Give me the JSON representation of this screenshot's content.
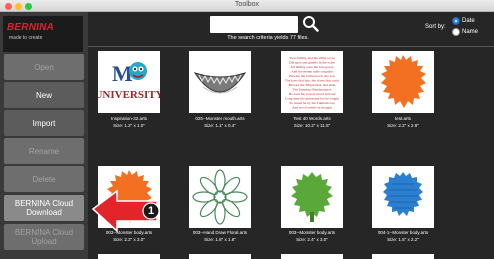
{
  "window": {
    "title": "Toolbox"
  },
  "logo": {
    "brand": "BERNINA",
    "tagline": "made to create"
  },
  "sidebar": {
    "buttons": [
      {
        "label": "Open",
        "state": "disabled"
      },
      {
        "label": "New",
        "state": "enabled"
      },
      {
        "label": "Import",
        "state": "enabled"
      },
      {
        "label": "Rename",
        "state": "disabled"
      },
      {
        "label": "Delete",
        "state": "disabled"
      },
      {
        "label": "BERNINA Cloud Download",
        "state": "active"
      },
      {
        "label": "BERNINA Cloud Upload",
        "state": "disabled"
      }
    ]
  },
  "search": {
    "value": "",
    "criteria_text": "The search criteria yields 77 files."
  },
  "sort": {
    "label": "Sort by:",
    "options": [
      {
        "label": "Date",
        "checked": true
      },
      {
        "label": "Name",
        "checked": false
      }
    ]
  },
  "files": [
    {
      "name": "Inspiration-32.arts",
      "size": "Size: 1.2\" x 1.0\"",
      "thumb": "university-monster-icon"
    },
    {
      "name": "025--Monster mouth.arts",
      "size": "Size: 1.1\" x 0.4\"",
      "thumb": "monster-mouth-icon"
    },
    {
      "name": "Test 40 Words.arts",
      "size": "Size: 10.2\" x 11.5\"",
      "thumb": "text-page-icon"
    },
    {
      "name": "test.arts",
      "size": "Size: 2.2\" x 2.9\"",
      "thumb": "orange-fur-icon"
    },
    {
      "name": "003--Monster body.arts",
      "size": "Size: 2.2\" x 2.0\"",
      "thumb": "orange-fur-icon"
    },
    {
      "name": "003--Hand Draw Floral.arts",
      "size": "Size: 1.8\" x 1.8\"",
      "thumb": "flower-outline-icon"
    },
    {
      "name": "003--Monster body.arts",
      "size": "Size: 2.4\" x 3.0\"",
      "thumb": "green-fur-icon"
    },
    {
      "name": "004-1--Monster body.arts",
      "size": "Size: 1.5\" x 2.2\"",
      "thumb": "blue-fur-icon"
    }
  ],
  "tile_text": {
    "university_m": "M",
    "university_word": "UNIVERSITY",
    "text_page_lines": [
      "Twas brillig, and the slithy toves",
      "Did gyre and gimble in the wabe",
      "All mimsy were the borogoves",
      "And the mome raths outgrabe",
      "Beware the Jabberwock, my son",
      "The jaws that bite, the claws that catch",
      "Beware the Jubjub bird, and shun",
      "The frumious Bandersnatch",
      "He took his vorpal sword in hand",
      "Long time the manxome foe he sought",
      "So rested he by the Tumtum tree",
      "And stood awhile in thought"
    ]
  },
  "callout": {
    "number": "1"
  },
  "colors": {
    "brand_red": "#d9232e",
    "accent_blue": "#2f83e6",
    "orange": "#f36f21",
    "green": "#5aa83a",
    "blue": "#2a7fd0"
  }
}
